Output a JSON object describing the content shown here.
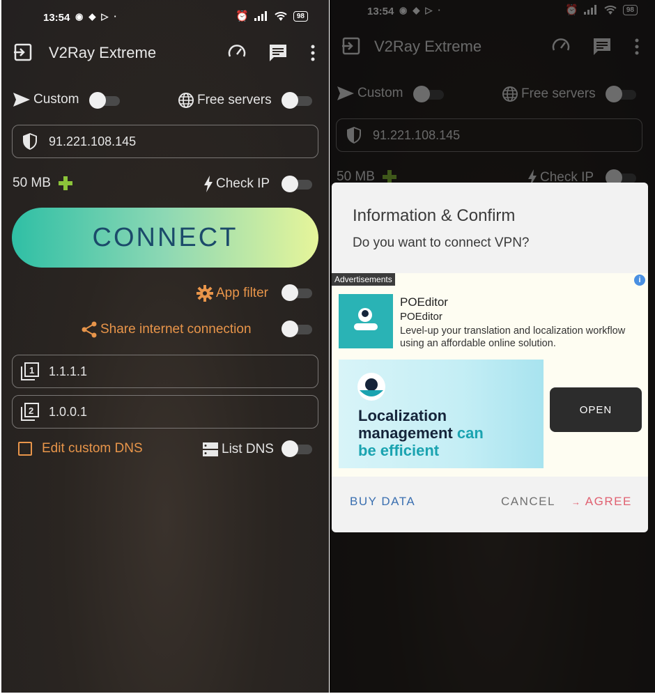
{
  "status": {
    "time": "13:54",
    "battery": "98"
  },
  "app": {
    "title": "V2Ray Extreme"
  },
  "options": {
    "custom_label": "Custom",
    "free_servers_label": "Free servers",
    "server_address": "91.221.108.145",
    "data_amount": "50 MB",
    "check_ip_label": "Check IP",
    "connect_label": "CONNECT",
    "app_filter_label": "App filter",
    "share_label": "Share internet connection",
    "dns1": "1.1.1.1",
    "dns2": "1.0.0.1",
    "edit_dns_label": "Edit custom DNS",
    "list_dns_label": "List DNS"
  },
  "dialog": {
    "title": "Information & Confirm",
    "message": "Do you want to connect VPN?",
    "buy_data": "BUY DATA",
    "cancel": "CANCEL",
    "agree": "AGREE",
    "agree_arrow": "→"
  },
  "ad": {
    "label": "Advertisements",
    "info": "i",
    "name": "POEditor",
    "advertiser": "POEditor",
    "description": "Level-up your translation and localization workflow using an affordable online solution.",
    "banner_line1": "Localization",
    "banner_line2": "management",
    "banner_line2b": "can",
    "banner_line3": "be efficient",
    "open_button": "OPEN"
  },
  "colors": {
    "accent_orange": "#e8954a",
    "connect_text": "#1b4a6a",
    "dialog_buy": "#3a6fb0",
    "dialog_agree": "#e06070"
  }
}
